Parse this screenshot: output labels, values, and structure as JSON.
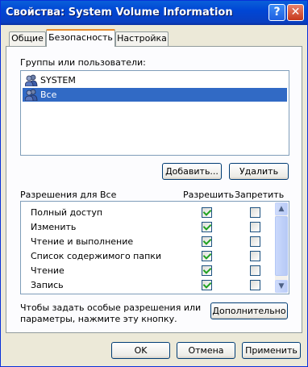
{
  "window": {
    "title": "Свойства: System Volume Information",
    "help_glyph": "?",
    "close_glyph": "✕"
  },
  "tabs": [
    {
      "label": "Общие",
      "active": false
    },
    {
      "label": "Безопасность",
      "active": true
    },
    {
      "label": "Настройка",
      "active": false
    }
  ],
  "groups": {
    "label": "Группы или пользователи:",
    "items": [
      {
        "label": "SYSTEM",
        "icon": "users-icon",
        "selected": false
      },
      {
        "label": "Все",
        "icon": "users-icon",
        "selected": true
      }
    ],
    "add_button": "Добавить...",
    "remove_button": "Удалить"
  },
  "permissions": {
    "label": "Разрешения для Все",
    "allow_header": "Разрешить",
    "deny_header": "Запретить",
    "rows": [
      {
        "name": "Полный доступ",
        "allow": true,
        "deny": false
      },
      {
        "name": "Изменить",
        "allow": true,
        "deny": false
      },
      {
        "name": "Чтение и выполнение",
        "allow": true,
        "deny": false
      },
      {
        "name": "Список содержимого папки",
        "allow": true,
        "deny": false
      },
      {
        "name": "Чтение",
        "allow": true,
        "deny": false
      },
      {
        "name": "Запись",
        "allow": true,
        "deny": false
      }
    ]
  },
  "advanced": {
    "text_line1": "Чтобы задать особые разрешения или",
    "text_line2": "параметры, нажмите эту кнопку.",
    "button": "Дополнительно"
  },
  "footer": {
    "ok": "OK",
    "cancel": "Отмена",
    "apply": "Применить"
  },
  "colors": {
    "titlebar": "#0a5fd9",
    "selection": "#316ac5",
    "check": "#21a121",
    "tab_highlight": "#e68b2c"
  }
}
